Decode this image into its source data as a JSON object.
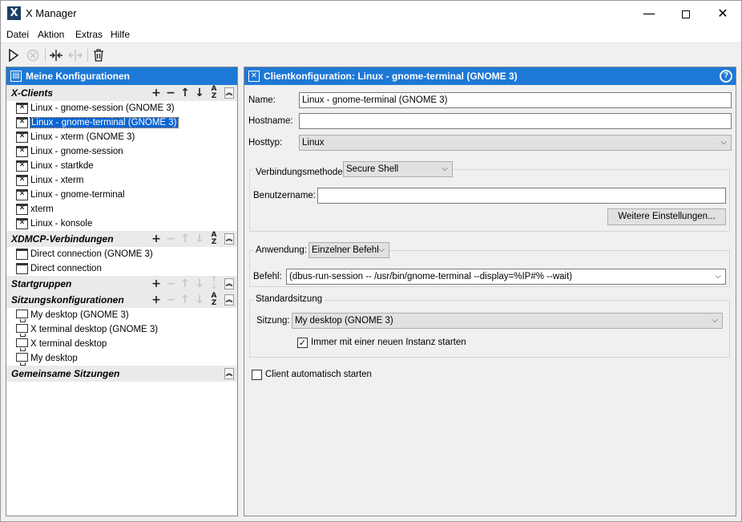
{
  "window": {
    "app_icon": "X",
    "title": "X Manager",
    "minimize": "—",
    "close": "✕"
  },
  "menu": [
    "Datei",
    "Aktion",
    "Extras",
    "Hilfe"
  ],
  "toolbar": {
    "icons": [
      "play-icon",
      "stop-icon",
      "merge-icon",
      "split-icon",
      "trash-icon"
    ]
  },
  "left_panel": {
    "title": "Meine Konfigurationen",
    "sections": [
      {
        "title": "X-Clients",
        "items": [
          "Linux - gnome-session (GNOME 3)",
          "Linux - gnome-terminal (GNOME 3)",
          "Linux - xterm (GNOME 3)",
          "Linux - gnome-session",
          "Linux - startkde",
          "Linux - xterm",
          "Linux - gnome-terminal",
          "xterm",
          "Linux - konsole"
        ],
        "selected_index": 1
      },
      {
        "title": "XDMCP-Verbindungen",
        "items": [
          "Direct connection (GNOME 3)",
          "Direct connection"
        ]
      },
      {
        "title": "Startgruppen",
        "items": []
      },
      {
        "title": "Sitzungskonfigurationen",
        "items": [
          "My desktop (GNOME 3)",
          "X terminal desktop (GNOME 3)",
          "X terminal desktop",
          "My desktop"
        ]
      },
      {
        "title": "Gemeinsame Sitzungen",
        "items": []
      }
    ]
  },
  "right_panel": {
    "title": "Clientkonfiguration:  Linux - gnome-terminal (GNOME 3)",
    "name_label": "Name:",
    "name_value": "Linux - gnome-terminal (GNOME 3)",
    "hostname_label": "Hostname:",
    "hostname_value": "",
    "hosttype_label": "Hosttyp:",
    "hosttype_value": "Linux",
    "connection_label": "Verbindungsmethode:",
    "connection_value": "Secure Shell",
    "username_label": "Benutzername:",
    "username_value": "",
    "more_settings_button": "Weitere Einstellungen...",
    "application_label": "Anwendung:",
    "application_value": "Einzelner Befehl",
    "command_label": "Befehl:",
    "command_value": "(dbus-run-session -- /usr/bin/gnome-terminal --display=%IP#% --wait)",
    "default_session_title": "Standardsitzung",
    "session_label": "Sitzung:",
    "session_value": "My desktop (GNOME 3)",
    "new_instance_label": "Immer mit einer neuen Instanz starten",
    "new_instance_checked": true,
    "autostart_label": "Client automatisch starten",
    "autostart_checked": false
  }
}
